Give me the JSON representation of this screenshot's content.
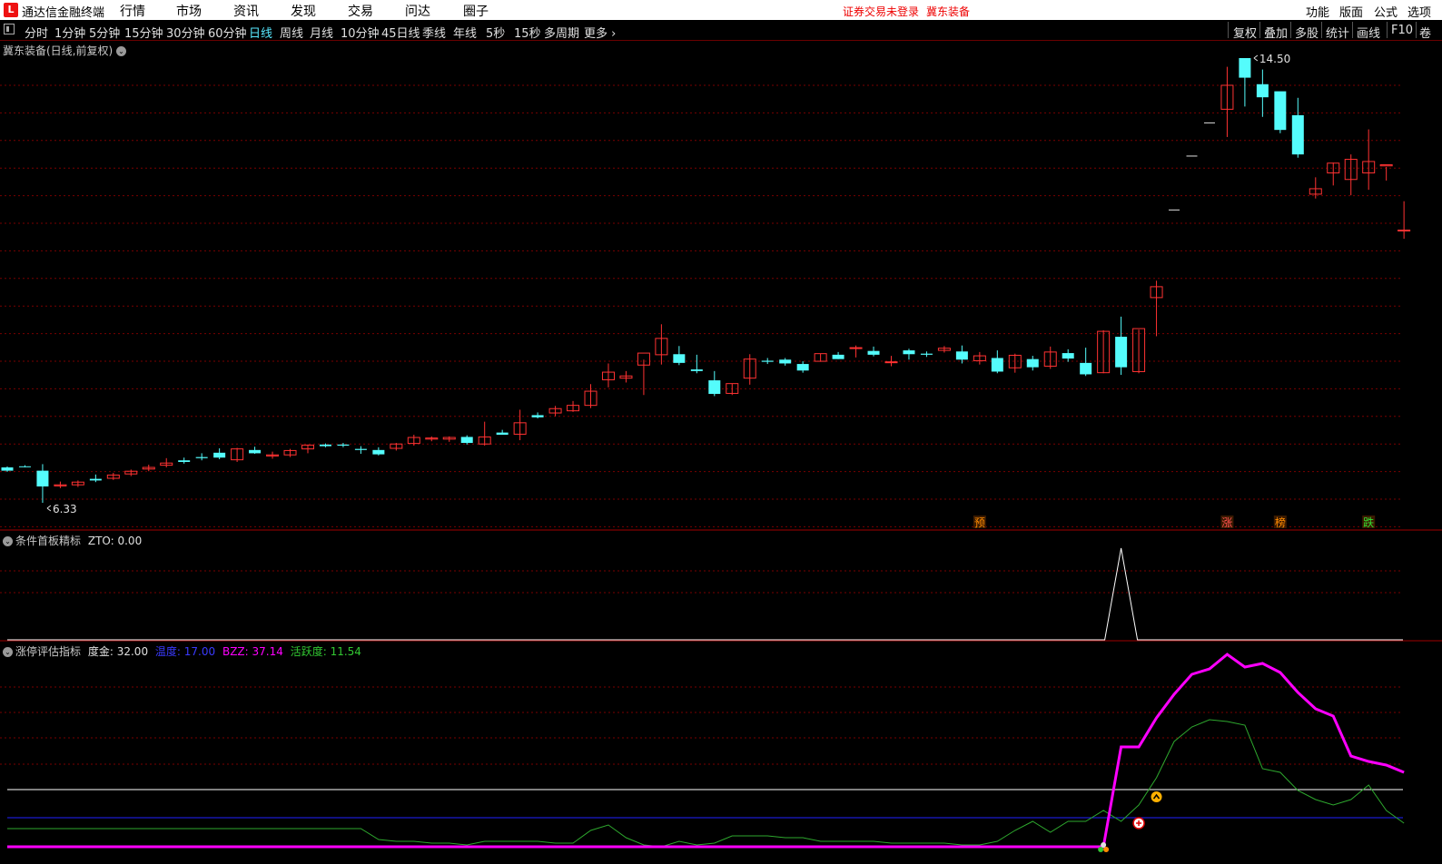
{
  "app": {
    "title": "通达信金融终端",
    "logo_glyph": "L",
    "menu": [
      "行情",
      "市场",
      "资讯",
      "发现",
      "交易",
      "问达",
      "圈子"
    ],
    "login_status": "证券交易未登录",
    "stock_name": "冀东装备",
    "right_menu": [
      "功能",
      "版面",
      "公式",
      "选项"
    ]
  },
  "toolbar": {
    "periods": [
      "分时",
      "1分钟",
      "5分钟",
      "15分钟",
      "30分钟",
      "60分钟",
      "日线",
      "周线",
      "月线",
      "10分钟",
      "45日线",
      "季线",
      "年线",
      "5秒",
      "15秒",
      "多周期",
      "更多"
    ],
    "active_period": "日线",
    "right_buttons": [
      "复权",
      "叠加",
      "多股",
      "统计",
      "画线",
      "F10",
      "卷"
    ]
  },
  "main_panel": {
    "title": "冀东装备(日线,前复权)",
    "high_label": "14.50",
    "low_label": "6.33",
    "markers": [
      {
        "text": "预",
        "color": "#ff8c00",
        "index": 55
      },
      {
        "text": "涨",
        "color": "#ff5050",
        "index": 69
      },
      {
        "text": "榜",
        "color": "#ff8c00",
        "index": 72
      },
      {
        "text": "跌",
        "color": "#32e032",
        "index": 77
      }
    ],
    "up_color": "#ff3232",
    "down_color": "#54fcfc"
  },
  "indicator1": {
    "title": "条件首板精标",
    "readout": "ZTO: 0.00",
    "peak_index": 63
  },
  "indicator2": {
    "title": "涨停评估指标",
    "readouts": [
      {
        "label": "度金:",
        "value": "32.00",
        "color": "#e0e0e0"
      },
      {
        "label": "温度:",
        "value": "17.00",
        "color": "#3a3aff"
      },
      {
        "label": "BZZ:",
        "value": "37.14",
        "color": "#ff00ff"
      },
      {
        "label": "活跃度:",
        "value": "11.54",
        "color": "#32c832"
      }
    ],
    "colors": {
      "bzz": "#ff00ff",
      "active": "#2ea82e",
      "white_line": "#ffffff",
      "blue_line": "#2020ff"
    }
  },
  "chart_data": {
    "type": "candlestick",
    "title": "冀东装备(日线,前复权)",
    "ohlc": [
      [
        6.98,
        7.0,
        6.9,
        6.92
      ],
      [
        7.0,
        7.02,
        6.98,
        6.99
      ],
      [
        6.92,
        7.04,
        6.33,
        6.63
      ],
      [
        6.64,
        6.72,
        6.6,
        6.66
      ],
      [
        6.66,
        6.74,
        6.62,
        6.71
      ],
      [
        6.77,
        6.85,
        6.71,
        6.74
      ],
      [
        6.78,
        6.88,
        6.75,
        6.84
      ],
      [
        6.86,
        6.94,
        6.82,
        6.91
      ],
      [
        6.95,
        7.03,
        6.91,
        6.98
      ],
      [
        7.02,
        7.15,
        6.98,
        7.06
      ],
      [
        7.11,
        7.16,
        7.05,
        7.08
      ],
      [
        7.17,
        7.24,
        7.11,
        7.15
      ],
      [
        7.25,
        7.33,
        7.13,
        7.16
      ],
      [
        7.12,
        7.34,
        7.08,
        7.32
      ],
      [
        7.3,
        7.36,
        7.23,
        7.24
      ],
      [
        7.19,
        7.27,
        7.14,
        7.21
      ],
      [
        7.21,
        7.32,
        7.17,
        7.29
      ],
      [
        7.32,
        7.4,
        7.24,
        7.39
      ],
      [
        7.4,
        7.42,
        7.35,
        7.37
      ],
      [
        7.4,
        7.43,
        7.35,
        7.38
      ],
      [
        7.32,
        7.37,
        7.23,
        7.3
      ],
      [
        7.3,
        7.35,
        7.2,
        7.22
      ],
      [
        7.33,
        7.43,
        7.29,
        7.41
      ],
      [
        7.42,
        7.58,
        7.38,
        7.53
      ],
      [
        7.5,
        7.55,
        7.46,
        7.52
      ],
      [
        7.5,
        7.55,
        7.45,
        7.53
      ],
      [
        7.54,
        7.57,
        7.4,
        7.43
      ],
      [
        7.41,
        7.82,
        7.38,
        7.54
      ],
      [
        7.62,
        7.67,
        7.58,
        7.58
      ],
      [
        7.59,
        8.04,
        7.48,
        7.8
      ],
      [
        7.94,
        7.99,
        7.88,
        7.9
      ],
      [
        7.98,
        8.11,
        7.92,
        8.06
      ],
      [
        8.02,
        8.2,
        8.0,
        8.12
      ],
      [
        8.12,
        8.51,
        8.07,
        8.38
      ],
      [
        8.59,
        8.89,
        8.45,
        8.73
      ],
      [
        8.62,
        8.75,
        8.54,
        8.66
      ],
      [
        8.86,
        8.96,
        8.31,
        9.08
      ],
      [
        9.05,
        9.61,
        8.87,
        9.35
      ],
      [
        9.06,
        9.21,
        8.86,
        8.9
      ],
      [
        8.78,
        9.05,
        8.71,
        8.75
      ],
      [
        8.58,
        8.75,
        8.29,
        8.33
      ],
      [
        8.34,
        8.52,
        8.31,
        8.52
      ],
      [
        8.62,
        9.06,
        8.5,
        8.97
      ],
      [
        8.94,
        8.99,
        8.88,
        8.92
      ],
      [
        8.96,
        8.99,
        8.85,
        8.89
      ],
      [
        8.88,
        8.93,
        8.72,
        8.76
      ],
      [
        8.93,
        9.07,
        8.92,
        9.07
      ],
      [
        9.05,
        9.1,
        8.97,
        8.97
      ],
      [
        9.17,
        9.22,
        9.0,
        9.18
      ],
      [
        9.12,
        9.2,
        9.02,
        9.05
      ],
      [
        8.92,
        9.03,
        8.84,
        8.92
      ],
      [
        9.13,
        9.16,
        8.96,
        9.06
      ],
      [
        9.07,
        9.11,
        9.01,
        9.05
      ],
      [
        9.13,
        9.21,
        9.09,
        9.17
      ],
      [
        9.11,
        9.22,
        8.89,
        8.96
      ],
      [
        8.94,
        9.1,
        8.87,
        9.03
      ],
      [
        8.99,
        9.13,
        8.71,
        8.74
      ],
      [
        8.81,
        9.07,
        8.72,
        9.04
      ],
      [
        8.97,
        9.03,
        8.76,
        8.82
      ],
      [
        8.84,
        9.2,
        8.79,
        9.1
      ],
      [
        9.08,
        9.15,
        8.92,
        8.98
      ],
      [
        8.9,
        9.18,
        8.66,
        8.69
      ],
      [
        8.72,
        9.5,
        8.71,
        9.48
      ],
      [
        9.38,
        9.75,
        8.68,
        8.82
      ],
      [
        8.74,
        9.51,
        8.71,
        9.53
      ],
      [
        10.1,
        10.41,
        9.39,
        10.3
      ],
      [
        11.71,
        11.71,
        11.71,
        11.71
      ],
      [
        12.7,
        12.7,
        12.7,
        12.7
      ],
      [
        13.31,
        13.31,
        13.31,
        13.31
      ],
      [
        13.56,
        14.34,
        13.05,
        14.0
      ],
      [
        14.5,
        14.5,
        13.61,
        14.14
      ],
      [
        14.02,
        14.29,
        13.42,
        13.78
      ],
      [
        13.89,
        13.86,
        13.12,
        13.18
      ],
      [
        13.45,
        13.77,
        12.67,
        12.73
      ],
      [
        12.0,
        12.31,
        11.92,
        12.1
      ],
      [
        12.39,
        12.58,
        12.16,
        12.57
      ],
      [
        12.27,
        12.73,
        11.98,
        12.64
      ],
      [
        12.39,
        13.19,
        12.08,
        12.6
      ],
      [
        12.52,
        12.5,
        12.25,
        12.54
      ],
      [
        11.34,
        11.87,
        11.18,
        11.34
      ]
    ],
    "ylim": [
      6.33,
      14.5
    ],
    "zto": "0.00",
    "indicator_readouts": {
      "度金": 32.0,
      "温度": 17.0,
      "BZZ": 37.14,
      "活跃度": 11.54
    }
  }
}
